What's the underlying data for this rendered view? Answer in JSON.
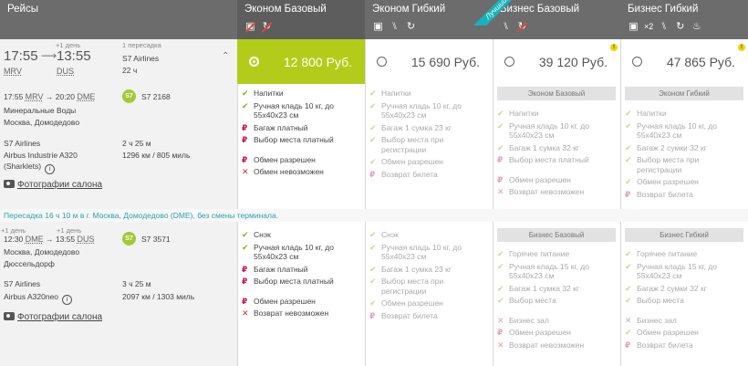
{
  "header": {
    "flights_label": "Рейсы",
    "fares": [
      {
        "name": "Эконом Базовый",
        "icons": [
          "no-baggage-icon",
          "no-refund-icon"
        ]
      },
      {
        "name": "Эконом Гибкий",
        "icons": [
          "baggage-icon",
          "seat-icon",
          "exchange-icon"
        ]
      },
      {
        "name": "Бизнес Базовый",
        "icons": [
          "seat-icon",
          "no-refund-icon"
        ]
      },
      {
        "name": "Бизнес Гибкий",
        "icons": [
          "baggage-x2-icon",
          "seat-icon",
          "exchange-icon",
          "lounge-icon"
        ],
        "x2": "×2"
      }
    ],
    "best_ribbon": "Лучший!"
  },
  "leg1": {
    "dep_time": "17:55",
    "arr_time": "13:55",
    "next_day": "+1 день",
    "dep_code": "MRV",
    "arr_code": "DUS",
    "stops": "1 пересадка",
    "airline": "S7 Airlines",
    "duration_total": "22 ч",
    "seg_dep": "17:55",
    "seg_dep_code": "MRV",
    "seg_arr": "20:20",
    "seg_arr_code": "DME",
    "seg_flight": "S7 2168",
    "seg_from": "Минеральные Воды",
    "seg_to": "Москва, Домодедово",
    "seg_airline": "S7 Airlines",
    "seg_duration": "2 ч 25 м",
    "seg_aircraft_1": "Airbus Industrie A320",
    "seg_aircraft_2": "(Sharklets)",
    "seg_distance": "1296 км / 805 миль",
    "photos": "Фотографии салона"
  },
  "transfer": "Пересадка 16 ч 10 м в г. Москва, Домодедово (DME), без смены терминала.",
  "leg2": {
    "next_day_a": "+1 день",
    "next_day_b": "+1 день",
    "seg_dep": "12:30",
    "seg_dep_code": "DME",
    "seg_arr": "13:55",
    "seg_arr_code": "DUS",
    "seg_flight": "S7 3571",
    "seg_from": "Москва, Домодедово",
    "seg_to": "Дюссельдорф",
    "seg_airline": "S7 Airlines",
    "seg_duration": "3 ч 25 м",
    "seg_aircraft": "Airbus A320neo",
    "seg_distance": "2097 км / 1303 миль",
    "photos": "Фотографии салона"
  },
  "prices": [
    {
      "value": "12 800",
      "currency": "Руб.",
      "selected": true
    },
    {
      "value": "15 690",
      "currency": "Руб.",
      "selected": false
    },
    {
      "value": "39 120",
      "currency": "Руб.",
      "selected": false,
      "warn": "!"
    },
    {
      "value": "47 865",
      "currency": "Руб.",
      "selected": false,
      "warn": "!"
    }
  ],
  "seg1_fares": [
    {
      "label": "",
      "features": [
        {
          "t": "ok",
          "lines": [
            "Напитки"
          ]
        },
        {
          "t": "ok",
          "lines": [
            "Ручная кладь 10 кг, до",
            "55x40x23 см"
          ]
        },
        {
          "t": "pay",
          "lines": [
            "Багаж платный"
          ]
        },
        {
          "t": "pay",
          "lines": [
            "Выбор места платный"
          ]
        },
        {
          "t": "pay",
          "lines": [
            "Обмен разрешен"
          ]
        },
        {
          "t": "no",
          "lines": [
            "Обмен невозможен"
          ]
        }
      ]
    },
    {
      "label": "",
      "features": [
        {
          "t": "ok",
          "lines": [
            "Напитки"
          ]
        },
        {
          "t": "ok",
          "lines": [
            "Ручная кладь 10 кг, до",
            "55x40x23 см"
          ]
        },
        {
          "t": "ok",
          "lines": [
            "Багаж 1 сумка 23 кг"
          ]
        },
        {
          "t": "ok",
          "lines": [
            "Выбор места при",
            "регистрации"
          ]
        },
        {
          "t": "ok",
          "lines": [
            "Обмен разрешен"
          ]
        },
        {
          "t": "pay",
          "lines": [
            "Возврат билета"
          ]
        }
      ]
    },
    {
      "label": "Эконом Базовый",
      "features": [
        {
          "t": "ok",
          "lines": [
            "Напитки"
          ]
        },
        {
          "t": "ok",
          "lines": [
            "Ручная кладь 10 кг, до",
            "55x40x23 см"
          ]
        },
        {
          "t": "ok",
          "lines": [
            "Багаж 1 сумка 32 кг"
          ]
        },
        {
          "t": "pay",
          "lines": [
            "Выбор места платный"
          ]
        },
        {
          "t": "pay",
          "lines": [
            "Обмен разрешен"
          ]
        },
        {
          "t": "no",
          "lines": [
            "Возврат невозможен"
          ]
        }
      ]
    },
    {
      "label": "Эконом Гибкий",
      "features": [
        {
          "t": "ok",
          "lines": [
            "Напитки"
          ]
        },
        {
          "t": "ok",
          "lines": [
            "Ручная кладь 10 кг, до",
            "55x40x23 см"
          ]
        },
        {
          "t": "ok",
          "lines": [
            "Багаж 2 сумки 32 кг"
          ]
        },
        {
          "t": "ok",
          "lines": [
            "Выбор места при",
            "регистрации"
          ]
        },
        {
          "t": "ok",
          "lines": [
            "Обмен разрешен"
          ]
        },
        {
          "t": "pay",
          "lines": [
            "Возврат билета"
          ]
        }
      ]
    }
  ],
  "seg2_fares": [
    {
      "label": "",
      "features": [
        {
          "t": "ok",
          "lines": [
            "Снэк"
          ]
        },
        {
          "t": "ok",
          "lines": [
            "Ручная кладь 10 кг, до",
            "55x40x23 см"
          ]
        },
        {
          "t": "pay",
          "lines": [
            "Багаж платный"
          ]
        },
        {
          "t": "pay",
          "lines": [
            "Выбор места платный"
          ]
        },
        {
          "t": "pay",
          "lines": [
            "Обмен разрешен"
          ]
        },
        {
          "t": "no",
          "lines": [
            "Возврат невозможен"
          ]
        }
      ]
    },
    {
      "label": "",
      "features": [
        {
          "t": "ok",
          "lines": [
            "Снэк"
          ]
        },
        {
          "t": "ok",
          "lines": [
            "Ручная кладь 10 кг, до",
            "55x40x23 см"
          ]
        },
        {
          "t": "ok",
          "lines": [
            "Багаж 1 сумка 23 кг"
          ]
        },
        {
          "t": "ok",
          "lines": [
            "Выбор места при",
            "регистрации"
          ]
        },
        {
          "t": "ok",
          "lines": [
            "Обмен разрешен"
          ]
        },
        {
          "t": "pay",
          "lines": [
            "Возврат билета"
          ]
        }
      ]
    },
    {
      "label": "Бизнес Базовый",
      "features": [
        {
          "t": "ok",
          "lines": [
            "Горячее питание"
          ]
        },
        {
          "t": "ok",
          "lines": [
            "Ручная кладь 15 кг, до",
            "55x40x23 см"
          ]
        },
        {
          "t": "ok",
          "lines": [
            "Багаж 1 сумка 32 кг"
          ]
        },
        {
          "t": "ok",
          "lines": [
            "Выбор места"
          ]
        },
        {
          "t": "no",
          "lines": [
            "Бизнес зал"
          ]
        },
        {
          "t": "pay",
          "lines": [
            "Обмен разрешен"
          ]
        },
        {
          "t": "no",
          "lines": [
            "Возврат невозможен"
          ]
        }
      ]
    },
    {
      "label": "Бизнес Гибкий",
      "features": [
        {
          "t": "ok",
          "lines": [
            "Горячее питание"
          ]
        },
        {
          "t": "ok",
          "lines": [
            "Ручная кладь 15 кг, до",
            "55x40x23 см"
          ]
        },
        {
          "t": "ok",
          "lines": [
            "Багаж 2 сумки 32 кг"
          ]
        },
        {
          "t": "ok",
          "lines": [
            "Выбор места"
          ]
        },
        {
          "t": "no",
          "lines": [
            "Бизнес зал"
          ]
        },
        {
          "t": "ok",
          "lines": [
            "Обмен разрешен"
          ]
        },
        {
          "t": "pay",
          "lines": [
            "Возврат билета"
          ]
        }
      ]
    }
  ]
}
